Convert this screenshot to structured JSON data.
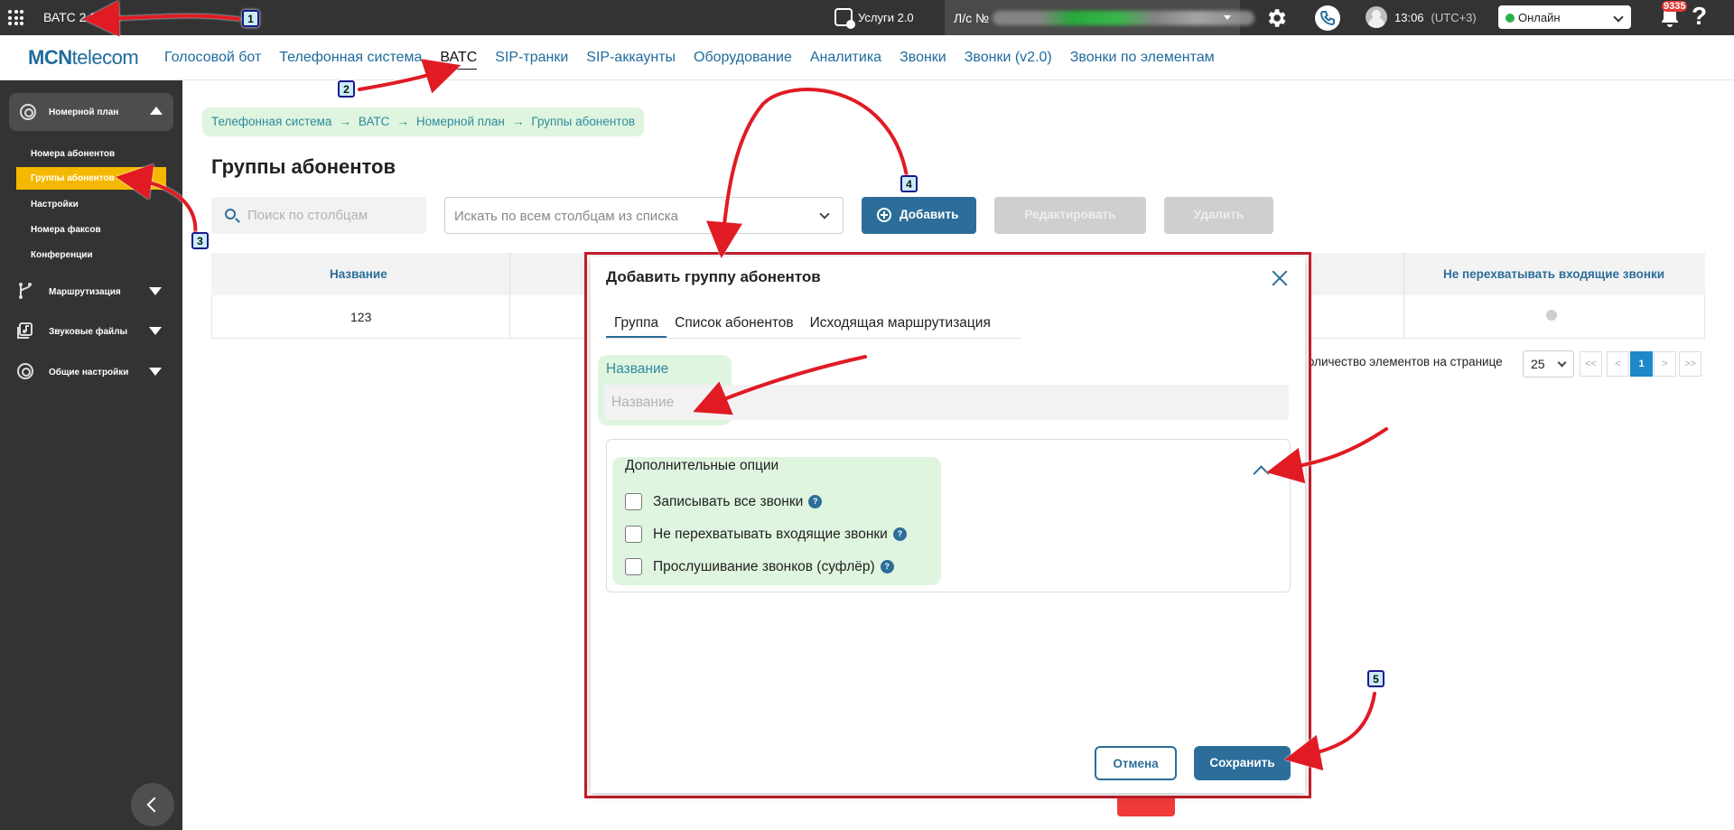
{
  "topbar": {
    "app_title": "ВАТС 2.0",
    "services_label": "Услуги 2.0",
    "account_label": "Л/с №",
    "time": "13:06",
    "timezone": "(UTC+3)",
    "status": "Онлайн",
    "notifications_count": "9335",
    "help": "?"
  },
  "nav": {
    "logo_bold": "MCN",
    "logo_light": "telecom",
    "items": [
      {
        "label": "Голосовой бот"
      },
      {
        "label": "Телефонная система"
      },
      {
        "label": "ВАТС",
        "active": true
      },
      {
        "label": "SIP-транки"
      },
      {
        "label": "SIP-аккаунты"
      },
      {
        "label": "Оборудование"
      },
      {
        "label": "Аналитика"
      },
      {
        "label": "Звонки"
      },
      {
        "label": "Звонки (v2.0)"
      },
      {
        "label": "Звонки по элементам"
      }
    ]
  },
  "sidebar": {
    "main_group": "Номерной план",
    "sub_items": [
      {
        "label": "Номера абонентов"
      },
      {
        "label": "Группы абонентов",
        "active": true
      },
      {
        "label": "Настройки"
      },
      {
        "label": "Номера факсов"
      },
      {
        "label": "Конференции"
      }
    ],
    "groups": [
      {
        "label": "Маршрутизация"
      },
      {
        "label": "Звуковые файлы"
      },
      {
        "label": "Общие настройки"
      }
    ]
  },
  "breadcrumb": [
    "Телефонная система",
    "ВАТС",
    "Номерной план",
    "Группы абонентов"
  ],
  "breadcrumb_sep": "→",
  "page": {
    "title": "Группы абонентов",
    "search_placeholder": "Поиск по столбцам",
    "filter_placeholder": "Искать по всем столбцам из списка",
    "add_label": "Добавить",
    "edit_label": "Редактировать",
    "delete_label": "Удалить"
  },
  "table": {
    "columns": [
      "Название",
      "Не перехватывать входящие звонки"
    ],
    "rows": [
      {
        "name": "123"
      }
    ]
  },
  "pager": {
    "label": "Количество элементов на странице",
    "page_size": "25",
    "first": "<<",
    "prev": "<",
    "current": "1",
    "next": ">",
    "last": ">>"
  },
  "modal": {
    "title": "Добавить группу абонентов",
    "tabs": [
      {
        "label": "Группа",
        "active": true
      },
      {
        "label": "Список абонентов"
      },
      {
        "label": "Исходящая маршрутизация"
      }
    ],
    "name_label": "Название",
    "name_placeholder": "Название",
    "options_title": "Дополнительные опции",
    "options": [
      {
        "label": "Записывать все звонки",
        "checked": false
      },
      {
        "label": "Не перехватывать входящие звонки",
        "checked": false
      },
      {
        "label": "Прослушивание звонков (суфлёр)",
        "checked": false
      }
    ],
    "help_mark": "?",
    "cancel_label": "Отмена",
    "save_label": "Сохранить"
  },
  "annotations": {
    "badges": [
      "1",
      "2",
      "3",
      "4",
      "5"
    ],
    "arrow_color": "#e01b24",
    "badge_border_color": "#1a1a8c",
    "highlight_color": "#dff5df"
  },
  "colors": {
    "accent": "#2c6e99",
    "topbar": "#333333",
    "sidebar_active": "#f5b800",
    "online": "#2bb24c",
    "modal_frame": "#c71e2c"
  }
}
